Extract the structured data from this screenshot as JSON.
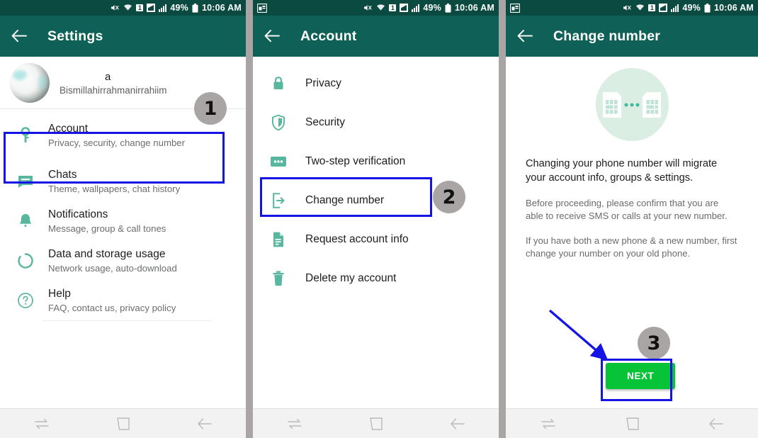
{
  "status_bar": {
    "icons": [
      "screenshot-icon",
      "mute-icon",
      "wifi-icon",
      "sim-badge-icon",
      "signal-1-icon",
      "signal-2-icon",
      "battery-icon"
    ],
    "sim_badge": "1",
    "battery_percent": "49%",
    "time": "10:06 AM"
  },
  "colors": {
    "status_bar": "#0b4a41",
    "app_bar": "#0f6157",
    "accent_teal": "#5bb9a2",
    "annotation_blue": "#1414e6",
    "annotation_gray": "#aaa5a5",
    "next_green": "#06c338",
    "illustration_bg": "#daeee4"
  },
  "panel1": {
    "title": "Settings",
    "back_icon": "back-arrow-icon",
    "profile": {
      "name_masked": "",
      "name_visible": "a",
      "status": "Bismillahirrahmanirrahiim",
      "avatar": "avatar-image"
    },
    "items": [
      {
        "icon": "key-icon",
        "title": "Account",
        "subtitle": "Privacy, security, change number"
      },
      {
        "icon": "chat-icon",
        "title": "Chats",
        "subtitle": "Theme, wallpapers, chat history"
      },
      {
        "icon": "bell-icon",
        "title": "Notifications",
        "subtitle": "Message, group & call tones"
      },
      {
        "icon": "data-usage-icon",
        "title": "Data and storage usage",
        "subtitle": "Network usage, auto-download"
      },
      {
        "icon": "help-icon",
        "title": "Help",
        "subtitle": "FAQ, contact us, privacy policy"
      }
    ],
    "annotation": {
      "number": "1",
      "highlight_target": "Account"
    }
  },
  "panel2": {
    "title": "Account",
    "back_icon": "back-arrow-icon",
    "items": [
      {
        "icon": "lock-icon",
        "title": "Privacy"
      },
      {
        "icon": "shield-icon",
        "title": "Security"
      },
      {
        "icon": "two-step-icon",
        "title": "Two-step verification"
      },
      {
        "icon": "change-number-icon",
        "title": "Change number"
      },
      {
        "icon": "document-icon",
        "title": "Request account info"
      },
      {
        "icon": "trash-icon",
        "title": "Delete my account"
      }
    ],
    "annotation": {
      "number": "2",
      "highlight_target": "Change number"
    }
  },
  "panel3": {
    "title": "Change number",
    "back_icon": "back-arrow-icon",
    "illustration": "sim-swap-illustration",
    "lead": "Changing your phone number will migrate your account info, groups & settings.",
    "para1": "Before proceeding, please confirm that you are able to receive SMS or calls at your new number.",
    "para2": "If you have both a new phone & a new number, first change your number on your old phone.",
    "next_label": "NEXT",
    "annotation": {
      "number": "3",
      "highlight_target": "NEXT",
      "arrow": "blue-arrow"
    }
  },
  "nav_bar": {
    "items": [
      "recents-icon",
      "home-icon",
      "back-icon"
    ]
  }
}
